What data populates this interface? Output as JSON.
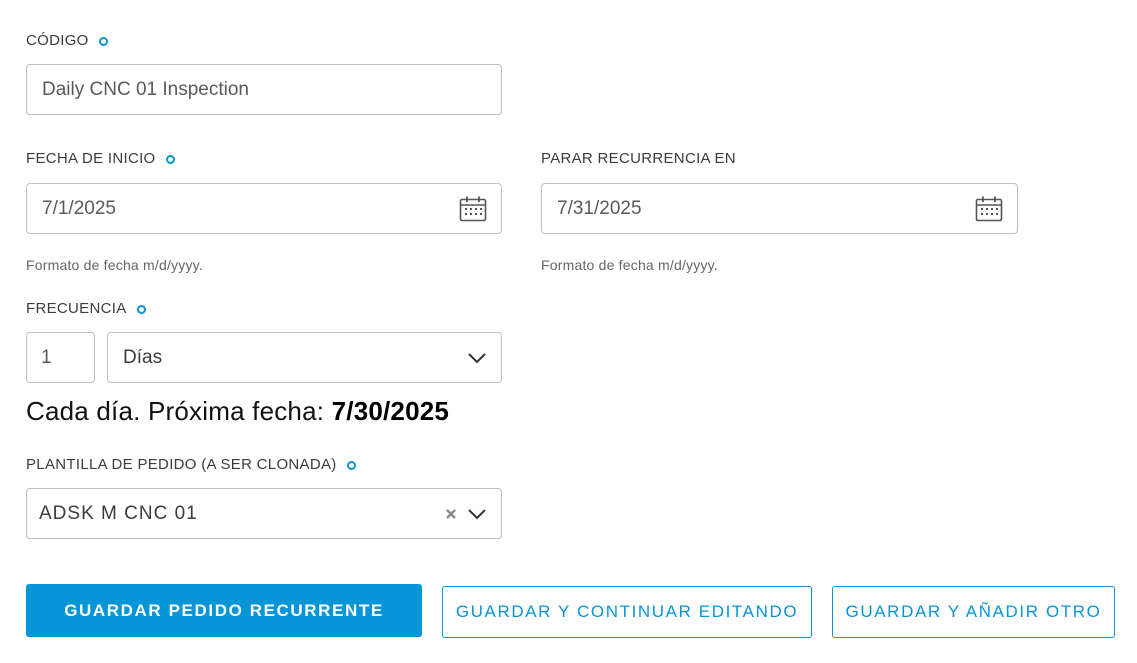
{
  "form": {
    "codigo": {
      "label": "CÓDIGO",
      "value": "Daily CNC 01 Inspection"
    },
    "fecha_inicio": {
      "label": "FECHA DE INICIO",
      "value": "7/1/2025",
      "hint": "Formato de fecha m/d/yyyy."
    },
    "parar_recurrencia": {
      "label": "PARAR RECURRENCIA EN",
      "value": "7/31/2025",
      "hint": "Formato de fecha m/d/yyyy."
    },
    "frecuencia": {
      "label": "FRECUENCIA",
      "count": "1",
      "unit": "Días"
    },
    "summary": {
      "text": "Cada día. Próxima fecha: ",
      "next_date": "7/30/2025"
    },
    "plantilla": {
      "label": "PLANTILLA DE PEDIDO (A SER CLONADA)",
      "value": "ADSK M CNC 01"
    }
  },
  "actions": {
    "save_recurring": "GUARDAR PEDIDO RECURRENTE",
    "save_continue": "GUARDAR Y CONTINUAR EDITANDO",
    "save_add": "GUARDAR Y AÑADIR OTRO"
  },
  "icons": {
    "required": "required-dot-icon",
    "calendar": "calendar-icon",
    "dropdown": "chevron-down-icon",
    "clear": "clear-x-icon"
  },
  "colors": {
    "accent": "#0696d7",
    "text": "#3c3c3c",
    "border": "#bfbfbf"
  }
}
